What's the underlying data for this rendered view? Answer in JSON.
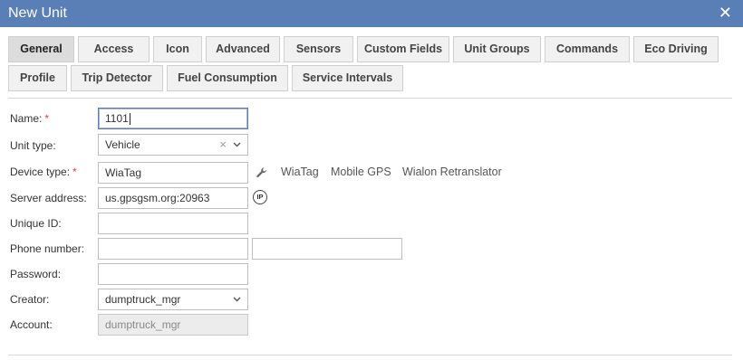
{
  "window": {
    "title": "New Unit",
    "close_glyph": "✕"
  },
  "tabs_row1": [
    "General",
    "Access",
    "Icon",
    "Advanced",
    "Sensors",
    "Custom Fields",
    "Unit Groups",
    "Commands",
    "Eco Driving"
  ],
  "tabs_row2": [
    "Profile",
    "Trip Detector",
    "Fuel Consumption",
    "Service Intervals"
  ],
  "active_tab": "General",
  "form": {
    "name": {
      "label": "Name:",
      "required": "*",
      "value": "1101"
    },
    "unit_type": {
      "label": "Unit type:",
      "value": "Vehicle",
      "clear_glyph": "×"
    },
    "device_type": {
      "label": "Device type:",
      "required": "*",
      "value": "WiaTag",
      "quick_options": [
        "WiaTag",
        "Mobile GPS",
        "Wialon Retranslator"
      ]
    },
    "server_address": {
      "label": "Server address:",
      "value": "us.gpsgsm.org:20963",
      "ip_icon_text": "IP"
    },
    "unique_id": {
      "label": "Unique ID:",
      "value": ""
    },
    "phone_number": {
      "label": "Phone number:",
      "value": "",
      "value2": ""
    },
    "password": {
      "label": "Password:",
      "value": ""
    },
    "creator": {
      "label": "Creator:",
      "value": "dumptruck_mgr"
    },
    "account": {
      "label": "Account:",
      "value": "dumptruck_mgr"
    }
  },
  "colors": {
    "titlebar": "#5a7fb6",
    "required": "#e0443a",
    "active_tab": "#dcdcdc"
  },
  "icons": [
    "close-icon",
    "clear-icon",
    "chevron-down-icon",
    "wrench-icon",
    "ip-icon"
  ]
}
